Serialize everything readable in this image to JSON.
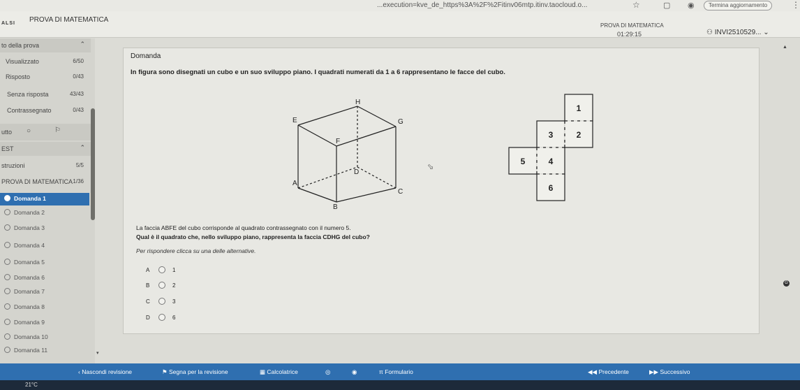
{
  "browser": {
    "url": "...execution=kve_de_https%3A%2F%2Fitinv06mtp.itinv.taocloud.o...",
    "update_label": "Termina aggiornamento"
  },
  "header": {
    "logo": "ALSI",
    "app_title": "PROVA DI MATEMATICA",
    "test_name": "PROVA DI MATEMATICA",
    "timer": "01:29:15",
    "user": "INVI2510529..."
  },
  "sidebar": {
    "section_title": "to della prova",
    "stats": [
      {
        "label": "Visualizzato",
        "count": "6/50"
      },
      {
        "label": "Risposto",
        "count": "0/43"
      },
      {
        "label": "Senza risposta",
        "count": "43/43"
      },
      {
        "label": "Contrassegnato",
        "count": "0/43"
      }
    ],
    "filter_label": "utto",
    "test_section": "EST",
    "instructions": {
      "label": "struzioni",
      "count": "5/5"
    },
    "part": {
      "label": "PROVA DI MATEMATICA",
      "count": "1/36"
    },
    "questions": [
      "Domanda 1",
      "Domanda 2",
      "Domanda 3",
      "Domanda 4",
      "Domanda 5",
      "Domanda 6",
      "Domanda 7",
      "Domanda 8",
      "Domanda 9",
      "Domanda 10",
      "Domanda 11"
    ]
  },
  "question": {
    "header": "Domanda",
    "intro": "In figura sono disegnati un cubo e un suo sviluppo piano. I quadrati numerati da 1 a 6 rappresentano le facce del cubo.",
    "cube_labels": {
      "H": "H",
      "E": "E",
      "G": "G",
      "F": "F",
      "D": "D",
      "A": "A",
      "C": "C",
      "B": "B"
    },
    "net_labels": [
      "1",
      "3",
      "2",
      "5",
      "4",
      "6"
    ],
    "text1": "La faccia ABFE del cubo corrisponde al quadrato contrassegnato con il numero 5.",
    "text2": "Qual è il quadrato che, nello sviluppo piano, rappresenta la faccia CDHG del cubo?",
    "instruction": "Per rispondere clicca su una delle alternative.",
    "options": [
      {
        "letter": "A",
        "value": "1"
      },
      {
        "letter": "B",
        "value": "2"
      },
      {
        "letter": "C",
        "value": "3"
      },
      {
        "letter": "D",
        "value": "6"
      }
    ]
  },
  "bottombar": {
    "hide_review": "Nascondi revisione",
    "mark_review": "Segna per la revisione",
    "calculator": "Calcolatrice",
    "formulary": "Formulario",
    "previous": "Precedente",
    "next": "Successivo"
  },
  "taskbar": {
    "temperature": "21°C"
  }
}
